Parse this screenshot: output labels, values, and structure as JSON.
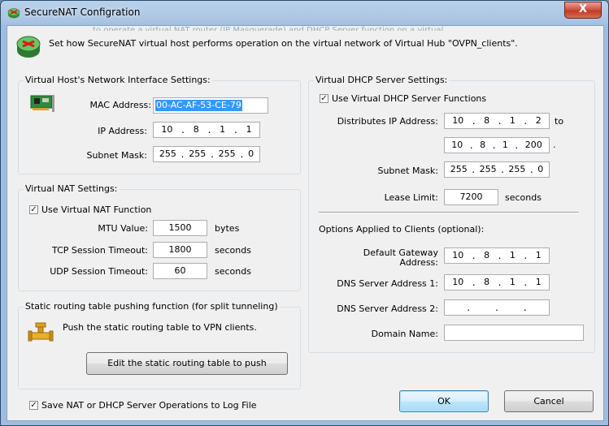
{
  "window": {
    "title": "SecureNAT Configration",
    "close_glyph": "X"
  },
  "ghost_text": "to operate a virtual NAT router (IP Masquerade) and DHCP Server function on a virtual",
  "header": {
    "description": "Set how SecureNAT virtual host performs operation on the virtual network of Virtual Hub \"OVPN_clients\"."
  },
  "host_settings": {
    "title": "Virtual Host's Network Interface Settings:",
    "mac_label": "MAC Address:",
    "mac_value": "00-AC-AF-53-CE-79",
    "ip_label": "IP Address:",
    "ip_octets": [
      "10",
      "8",
      "1",
      "1"
    ],
    "mask_label": "Subnet Mask:",
    "mask_octets": [
      "255",
      "255",
      "255",
      "0"
    ]
  },
  "nat_settings": {
    "title": "Virtual NAT Settings:",
    "use_nat_label": "Use Virtual NAT Function",
    "use_nat_checked": true,
    "mtu_label": "MTU Value:",
    "mtu_value": "1500",
    "mtu_unit": "bytes",
    "tcp_label": "TCP Session Timeout:",
    "tcp_value": "1800",
    "tcp_unit": "seconds",
    "udp_label": "UDP Session Timeout:",
    "udp_value": "60",
    "udp_unit": "seconds"
  },
  "routing": {
    "title": "Static routing table pushing function (for split tunneling)",
    "description": "Push the static routing table to VPN clients.",
    "edit_button": "Edit the static routing table to push"
  },
  "save_log": {
    "label": "Save NAT or DHCP Server Operations to Log File",
    "checked": true
  },
  "dhcp": {
    "title": "Virtual DHCP Server Settings:",
    "use_dhcp_label": "Use Virtual DHCP Server Functions",
    "use_dhcp_checked": true,
    "range_label": "Distributes IP Address:",
    "range_start": [
      "10",
      "8",
      "1",
      "2"
    ],
    "to_label": "to",
    "range_end": [
      "10",
      "8",
      "1",
      "200"
    ],
    "period": ".",
    "mask_label": "Subnet Mask:",
    "mask_octets": [
      "255",
      "255",
      "255",
      "0"
    ],
    "lease_label": "Lease Limit:",
    "lease_value": "7200",
    "lease_unit": "seconds",
    "options_title": "Options Applied to Clients (optional):",
    "gateway_label_1": "Default Gateway",
    "gateway_label_2": "Address:",
    "gateway_octets": [
      "10",
      "8",
      "1",
      "1"
    ],
    "dns1_label": "DNS Server Address 1:",
    "dns1_octets": [
      "10",
      "8",
      "1",
      "1"
    ],
    "dns2_label": "DNS Server Address 2:",
    "dns2_octets": [
      "",
      "",
      "",
      ""
    ],
    "domain_label": "Domain Name:",
    "domain_value": ""
  },
  "buttons": {
    "ok": "OK",
    "cancel": "Cancel"
  },
  "dot": "."
}
